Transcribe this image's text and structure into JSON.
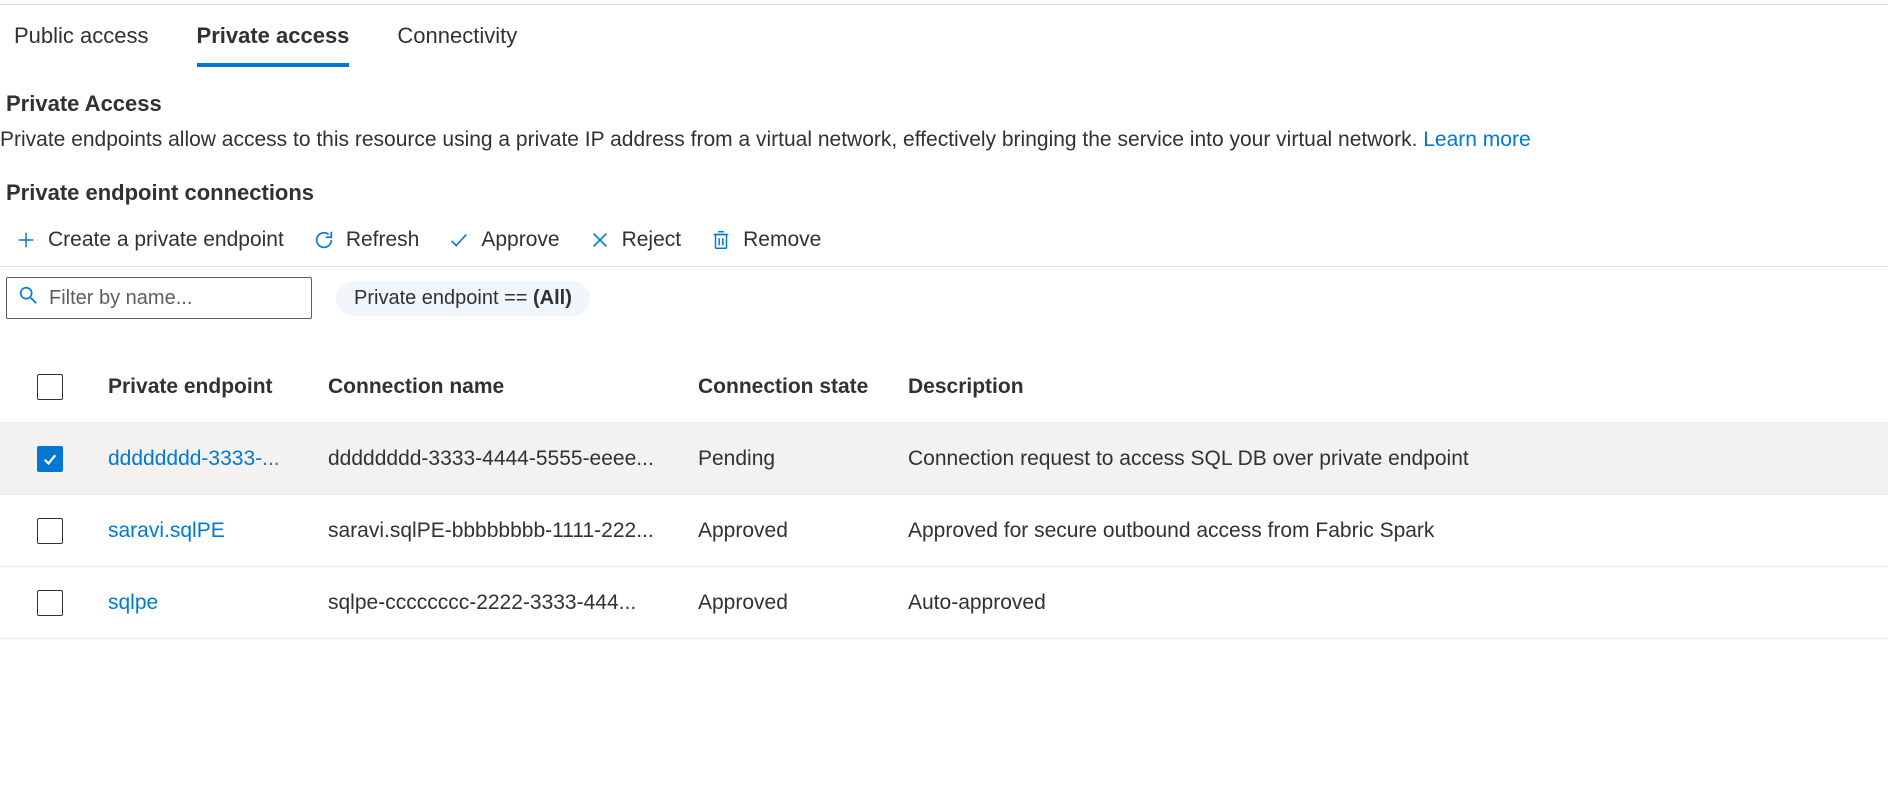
{
  "tabs": [
    {
      "label": "Public access",
      "active": false
    },
    {
      "label": "Private access",
      "active": true
    },
    {
      "label": "Connectivity",
      "active": false
    }
  ],
  "privateAccess": {
    "title": "Private Access",
    "description": "Private endpoints allow access to this resource using a private IP address from a virtual network, effectively bringing the service into your virtual network. ",
    "learnMore": "Learn more"
  },
  "connections": {
    "title": "Private endpoint connections",
    "toolbar": {
      "create": "Create a private endpoint",
      "refresh": "Refresh",
      "approve": "Approve",
      "reject": "Reject",
      "remove": "Remove"
    },
    "filter": {
      "placeholder": "Filter by name...",
      "pillPrefix": "Private endpoint == ",
      "pillValue": "(All)"
    },
    "columns": {
      "endpoint": "Private endpoint",
      "connName": "Connection name",
      "state": "Connection state",
      "desc": "Description"
    },
    "rows": [
      {
        "selected": true,
        "endpoint": "dddddddd-3333-...",
        "connName": "dddddddd-3333-4444-5555-eeee...",
        "state": "Pending",
        "desc": "Connection request to access SQL DB over private endpoint"
      },
      {
        "selected": false,
        "endpoint": "saravi.sqlPE",
        "connName": "saravi.sqlPE-bbbbbbbb-1111-222...",
        "state": "Approved",
        "desc": "Approved for secure outbound access from Fabric Spark"
      },
      {
        "selected": false,
        "endpoint": "sqlpe",
        "connName": "sqlpe-cccccccc-2222-3333-444...",
        "state": "Approved",
        "desc": "Auto-approved"
      }
    ]
  },
  "colors": {
    "accent": "#0078d4",
    "text": "#323130",
    "border": "#e1dfdd",
    "pillBg": "#eff6fc",
    "rowSelected": "#f3f2f1"
  }
}
